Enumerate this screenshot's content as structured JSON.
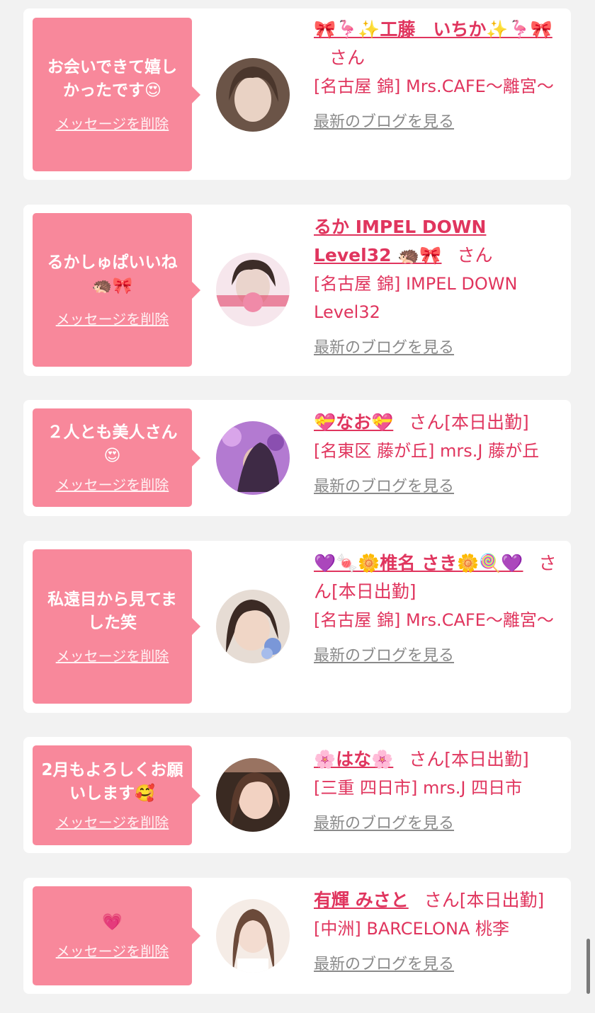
{
  "messages": [
    {
      "message": "お会いできて嬉しかったです😍",
      "delete_label": "メッセージを削除",
      "name": "🎀🦩✨工藤　いちか✨🦩🎀",
      "honorific": "さん",
      "status": "",
      "shop": "[名古屋 錦] Mrs.CAFE〜離宮〜",
      "blog_label": "最新のブログを見る",
      "avatar_colors": [
        "#6b5447",
        "#e9d2c4"
      ]
    },
    {
      "message": "るかしゅぱいいね🦔🎀",
      "delete_label": "メッセージを削除",
      "name": "るか IMPEL DOWN Level32 🦔🎀",
      "honorific": "さん",
      "status": "",
      "shop": "[名古屋 錦] IMPEL DOWN Level32",
      "blog_label": "最新のブログを見る",
      "avatar_colors": [
        "#f3c6d6",
        "#e0355e"
      ]
    },
    {
      "message": "２人とも美人さん😍",
      "delete_label": "メッセージを削除",
      "name": "💝なお💝",
      "honorific": "さん",
      "status": "[本日出勤]",
      "shop": "[名東区 藤が丘] mrs.J 藤が丘",
      "blog_label": "最新のブログを見る",
      "avatar_colors": [
        "#b37ad1",
        "#3e2a45"
      ]
    },
    {
      "message": "私遠目から見てました笑",
      "delete_label": "メッセージを削除",
      "name": "💜🍬🌼椎名 さき🌼🍭💜",
      "honorific": "さん",
      "status": "[本日出勤]",
      "shop": "[名古屋 錦] Mrs.CAFE〜離宮〜",
      "blog_label": "最新のブログを見る",
      "avatar_colors": [
        "#d8b8a2",
        "#7a97d8"
      ]
    },
    {
      "message": "2月もよろしくお願いします🥰",
      "delete_label": "メッセージを削除",
      "name": "🌸はな🌸",
      "honorific": "さん",
      "status": "[本日出勤]",
      "shop": "[三重 四日市] mrs.J 四日市",
      "blog_label": "最新のブログを見る",
      "avatar_colors": [
        "#3a2a22",
        "#d9a58c"
      ]
    },
    {
      "message": "💗",
      "delete_label": "メッセージを削除",
      "name": "有輝 みさと",
      "honorific": "さん",
      "status": "[本日出勤]",
      "shop": "[中洲] BARCELONA 桃李",
      "blog_label": "最新のブログを見る",
      "avatar_colors": [
        "#f5ece6",
        "#6b4a3a"
      ]
    }
  ]
}
